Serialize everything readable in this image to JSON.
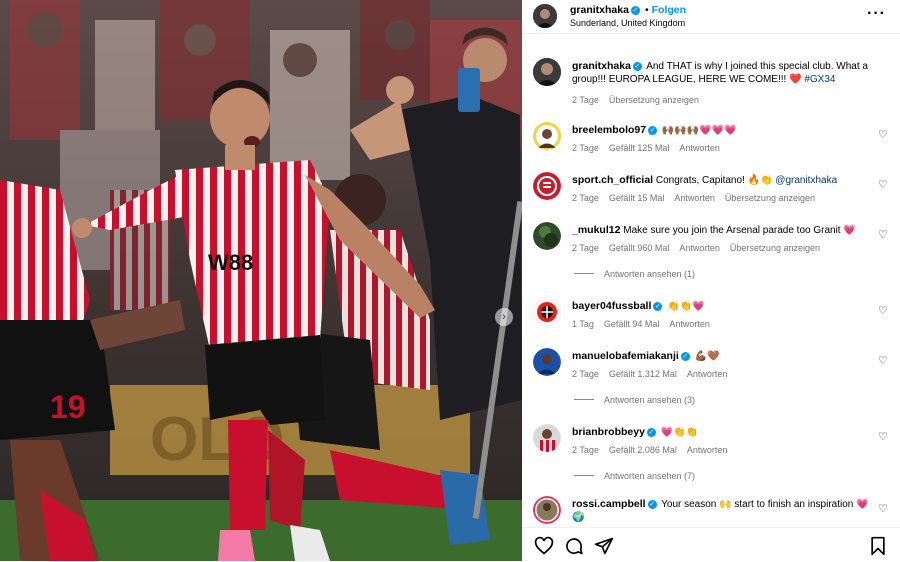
{
  "post": {
    "username": "granitxhaka",
    "follow_label": "Folgen",
    "location": "Sunderland, United Kingdom",
    "caption": "And THAT is why I joined this special club. What a group!!! EUROPA LEAGUE, HERE WE COME!!! ❤️",
    "hashtag": "#GX34",
    "time": "2 Tage",
    "translate_label": "Übersetzung anzeigen"
  },
  "comments": [
    {
      "user": "breelembolo97",
      "text": "🙌🏾🙌🏾🙌🏾💗💗💗",
      "time": "2 Tage",
      "likes": "Gefällt 125 Mal",
      "reply": "Antworten",
      "translate": ""
    },
    {
      "user": "sport.ch_official",
      "text": "Congrats, Capitano! 🔥👏",
      "mention": "@granitxhaka",
      "time": "2 Tage",
      "likes": "Gefällt 15 Mal",
      "reply": "Antworten",
      "translate": "Übersetzung anzeigen"
    },
    {
      "user": "_mukul12",
      "text": "Make sure you join the Arsenal parade too Granit 💗",
      "time": "2 Tage",
      "likes": "Gefällt 960 Mal",
      "reply": "Antworten",
      "translate": "Übersetzung anzeigen",
      "view_replies": "Antworten ansehen (1)"
    },
    {
      "user": "bayer04fussball",
      "text": "👏👏💗",
      "time": "1 Tag",
      "likes": "Gefällt 94 Mal",
      "reply": "Antworten",
      "translate": ""
    },
    {
      "user": "manuelobafemiakanji",
      "text": "💪🏾🤎",
      "time": "2 Tage",
      "likes": "Gefällt 1.312 Mal",
      "reply": "Antworten",
      "translate": "",
      "view_replies": "Antworten ansehen (3)"
    },
    {
      "user": "brianbrobbeyy",
      "text": "💗👏👏",
      "time": "2 Tage",
      "likes": "Gefällt 2.086 Mal",
      "reply": "Antworten",
      "translate": "",
      "view_replies": "Antworten ansehen (7)"
    },
    {
      "user": "rossi.campbell",
      "text": "Your season 🙌 start to finish an inspiration 💗🌍",
      "time": "",
      "likes": "",
      "reply": "",
      "translate": ""
    }
  ],
  "icons": {
    "more": "more-options-icon",
    "like": "heart-icon",
    "comment": "comment-icon",
    "share": "send-icon",
    "save": "bookmark-icon",
    "verified": "verified-badge-icon"
  },
  "colors": {
    "accent": "#0095f6",
    "link": "#00376b",
    "muted": "#737373"
  }
}
